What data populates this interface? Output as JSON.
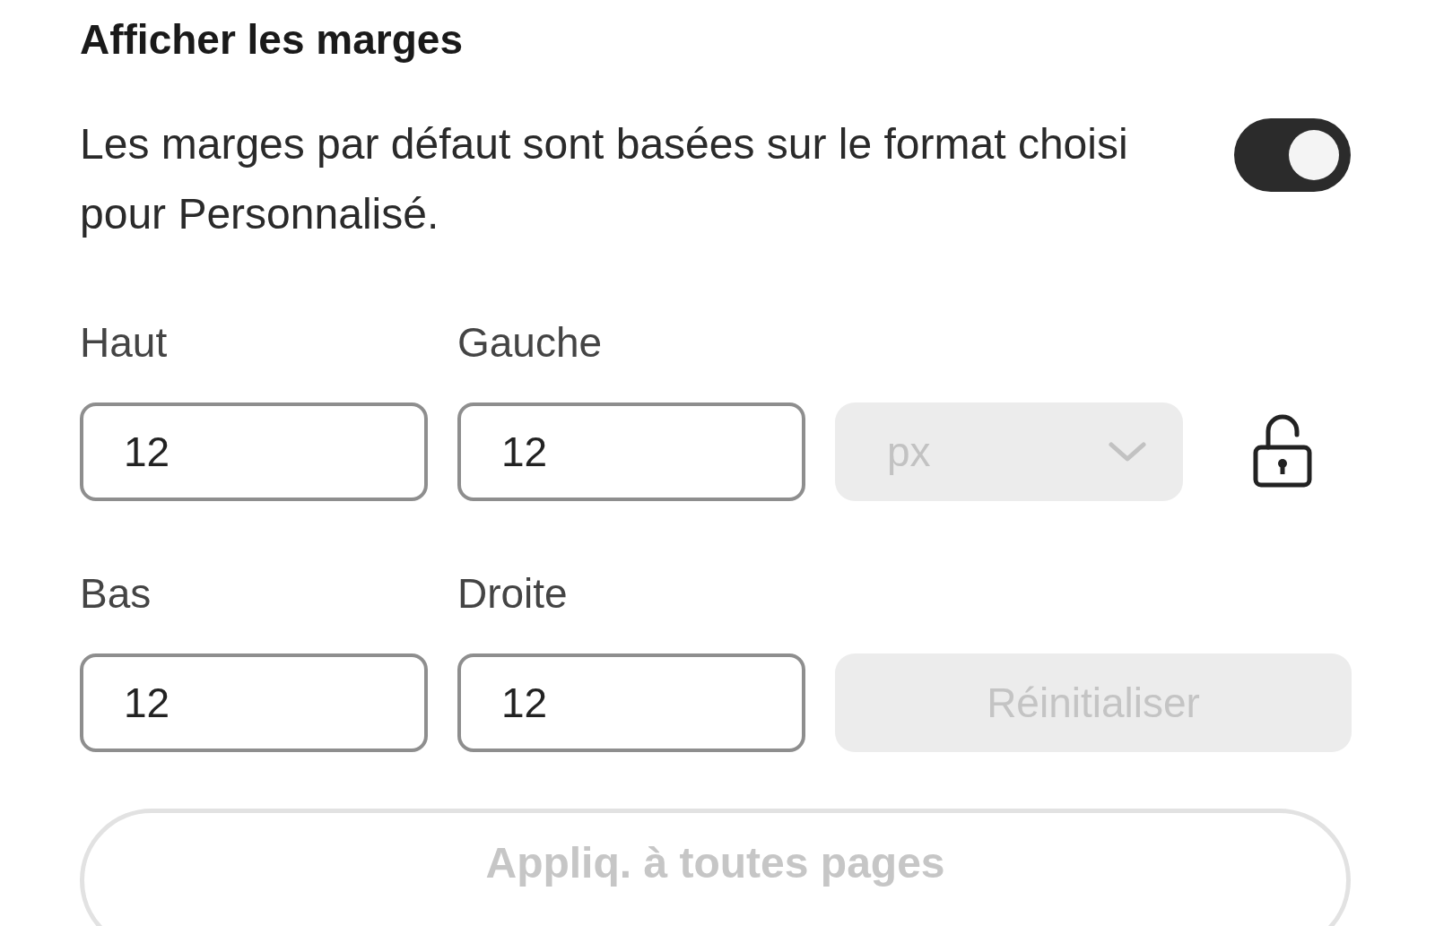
{
  "section": {
    "title": "Afficher les marges",
    "description": "Les marges par défaut sont basées sur le format choisi pour Personnalisé.",
    "show_margins_toggle": {
      "on": true
    }
  },
  "fields": [
    {
      "label": "Haut",
      "value": "12"
    },
    {
      "label": "Gauche",
      "value": "12"
    },
    {
      "label": "Bas",
      "value": "12"
    },
    {
      "label": "Droite",
      "value": "12"
    }
  ],
  "unit_dropdown": {
    "value": "px",
    "disabled": true
  },
  "lock": {
    "locked": false
  },
  "reset_button": {
    "label": "Réinitialiser",
    "disabled": true
  },
  "apply_button": {
    "label": "Appliq. à toutes pages",
    "disabled": true
  }
}
